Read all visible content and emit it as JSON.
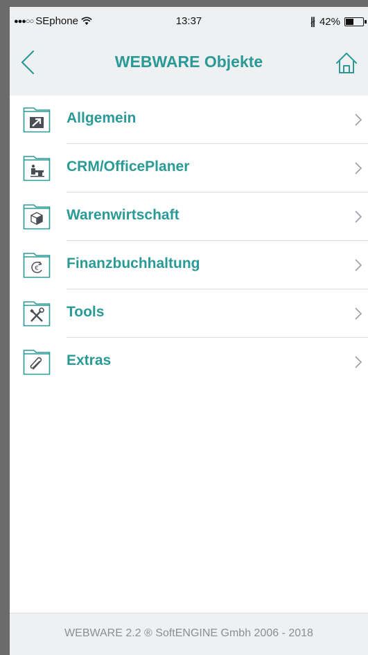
{
  "status_bar": {
    "signal": "●●●○○",
    "carrier": "SEphone",
    "wifi_icon": "wifi-icon",
    "time": "13:37",
    "bluetooth": "∦",
    "battery_percent": "42%",
    "battery_level": 0.42
  },
  "nav": {
    "title": "WEBWARE Objekte",
    "back_icon": "chevron-left-icon",
    "home_icon": "home-icon"
  },
  "items": [
    {
      "label": "Allgemein",
      "icon": "folder-arrow-icon"
    },
    {
      "label": "CRM/OfficePlaner",
      "icon": "folder-desk-icon"
    },
    {
      "label": "Warenwirtschaft",
      "icon": "folder-box-icon"
    },
    {
      "label": "Finanzbuchhaltung",
      "icon": "folder-euro-icon"
    },
    {
      "label": "Tools",
      "icon": "folder-tools-icon"
    },
    {
      "label": "Extras",
      "icon": "folder-paperclip-icon"
    }
  ],
  "footer": {
    "text": "WEBWARE 2.2 ® SoftENGINE Gmbh 2006 - 2018"
  },
  "colors": {
    "accent": "#2a9a96",
    "header_bg": "#eef0f2",
    "divider": "#d9dcdf",
    "footer_text": "#8a8f94"
  }
}
